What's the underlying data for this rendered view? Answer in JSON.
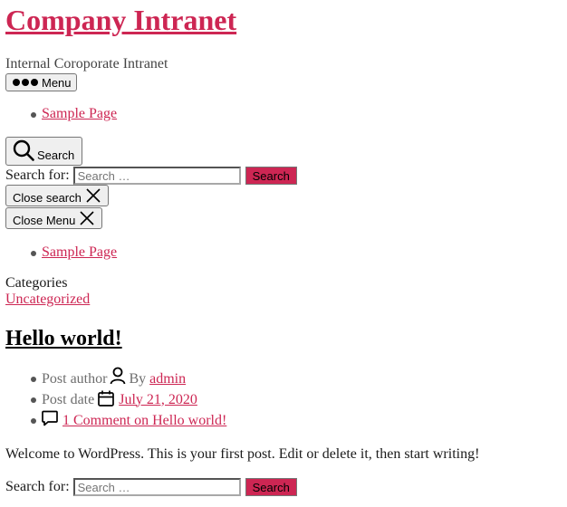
{
  "site": {
    "title": "Company Intranet",
    "description": "Internal Coroporate Intranet"
  },
  "header": {
    "menu_button_label": "Menu",
    "nav_items": [
      "Sample Page"
    ],
    "search_toggle_label": "Search"
  },
  "search_modal": {
    "label": "Search for:",
    "placeholder": "Search …",
    "submit_label": "Search",
    "close_label": "Close search"
  },
  "menu_modal": {
    "close_label": "Close Menu",
    "nav_items": [
      "Sample Page"
    ]
  },
  "post": {
    "categories_label": "Categories",
    "category": "Uncategorized",
    "title": "Hello world!",
    "author_label": "Post author",
    "by_text": "By",
    "author": "admin",
    "date_label": "Post date",
    "date": "July 21, 2020",
    "comments_link": "1 Comment on Hello world!",
    "excerpt": "Welcome to WordPress. This is your first post. Edit or delete it, then start writing!"
  },
  "footer_search": {
    "label": "Search for:",
    "placeholder": "Search …",
    "submit_label": "Search"
  },
  "colors": {
    "accent": "#cd2653",
    "button_bg": "#efefef"
  },
  "icons": [
    "dots-icon",
    "search-icon",
    "close-icon",
    "person-icon",
    "calendar-icon",
    "comment-icon"
  ]
}
